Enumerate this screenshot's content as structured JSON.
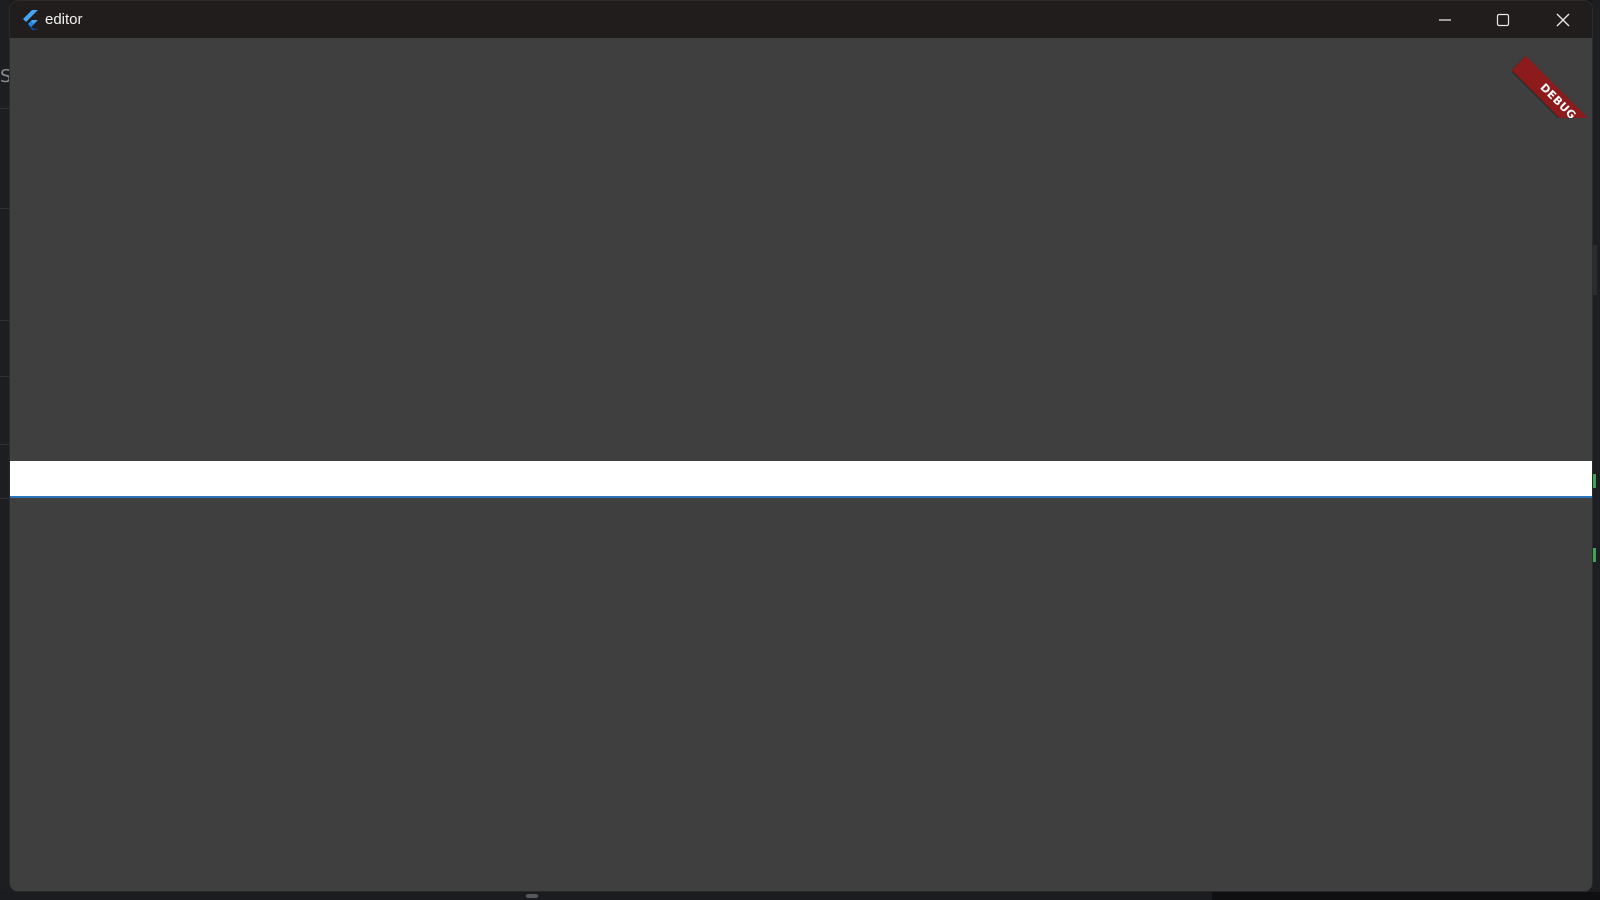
{
  "window": {
    "title": "editor",
    "app_icon": "flutter-logo-icon",
    "controls": {
      "minimize_icon": "minimize-icon",
      "maximize_icon": "maximize-icon",
      "close_icon": "close-icon"
    }
  },
  "debug_banner": {
    "label": "DEBUG",
    "color": "#8e1b1b"
  },
  "editor": {
    "input_value": "",
    "accent_color": "#2a73b8",
    "background_color": "#3f3f3f"
  },
  "background": {
    "left_glyph": "S"
  }
}
